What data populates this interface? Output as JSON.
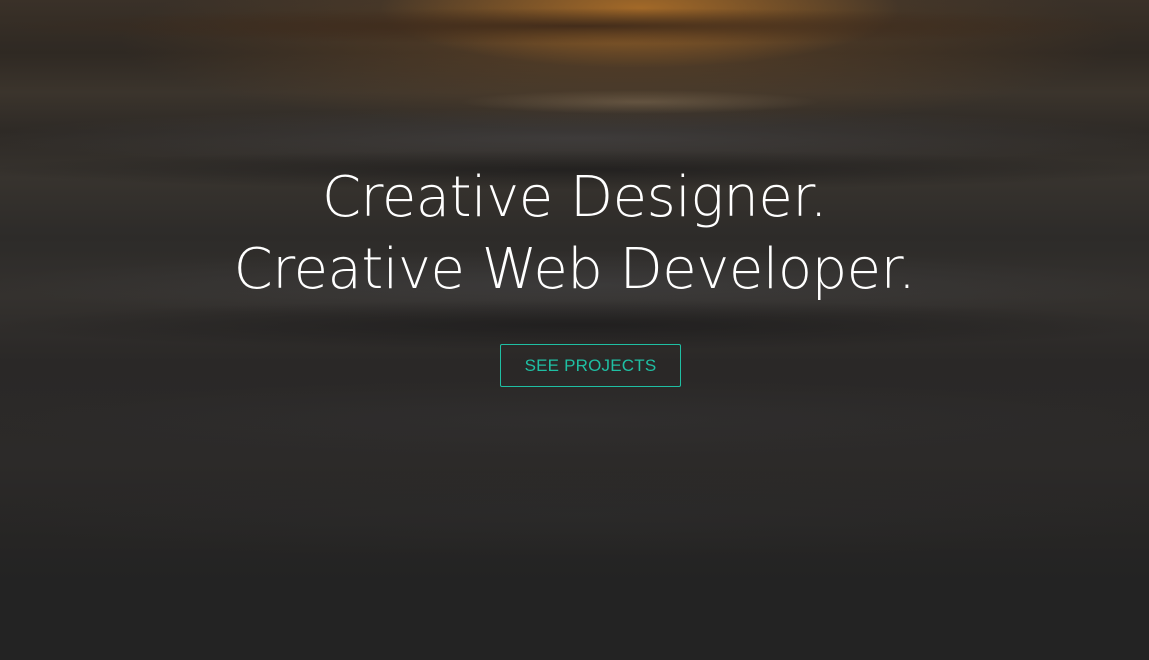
{
  "hero": {
    "headline_line1": "Creative Designer.",
    "headline_line2": "Creative Web Developer.",
    "cta_label": "SEE PROJECTS"
  },
  "colors": {
    "accent": "#1fbfa3",
    "headline_text": "#ffffff",
    "page_background": "#232323"
  }
}
